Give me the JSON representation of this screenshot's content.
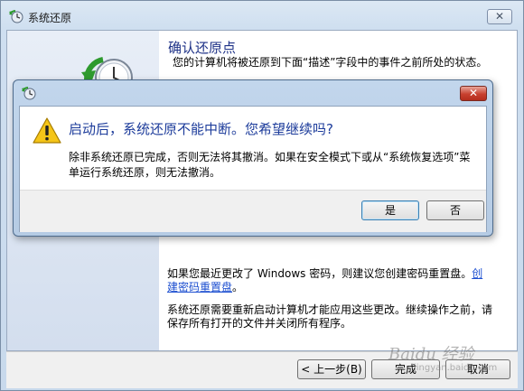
{
  "background_window": {
    "title": "系统还原",
    "close_glyph": "✕",
    "content_title": "确认还原点",
    "content_desc": "您的计算机将被还原到下面“描述”字段中的事件之前所处的状态。",
    "password_note_text": "如果您最近更改了 Windows 密码，则建议您创建密码重置盘。",
    "password_link": "创建密码重置盘",
    "password_note_end": "。",
    "restart_note": "系统还原需要重新启动计算机才能应用这些更改。继续操作之前，请保存所有打开的文件并关闭所有程序。",
    "buttons": {
      "back": "< 上一步(B)",
      "finish": "完成",
      "cancel": "取消"
    }
  },
  "dialog": {
    "close_glyph": "✕",
    "main_instruction": "启动后，系统还原不能中断。您希望继续吗?",
    "content": "除非系统还原已完成，否则无法将其撤消。如果在安全模式下或从“系统恢复选项”菜单运行系统还原，则无法撤消。",
    "buttons": {
      "yes": "是",
      "no": "否"
    }
  },
  "icons": {
    "window_icon": "system-restore-icon",
    "hero_icon": "system-restore-clock-icon",
    "dialog_icon": "system-restore-icon",
    "warning_icon": "warning-icon"
  },
  "colors": {
    "title_blue": "#1d3c9b",
    "link_blue": "#1d4fd0",
    "close_red": "#c8412f",
    "warning_yellow": "#f5c518"
  },
  "watermark": {
    "text": "Baidu 经验",
    "sub": "jingyan.baidu.com"
  }
}
